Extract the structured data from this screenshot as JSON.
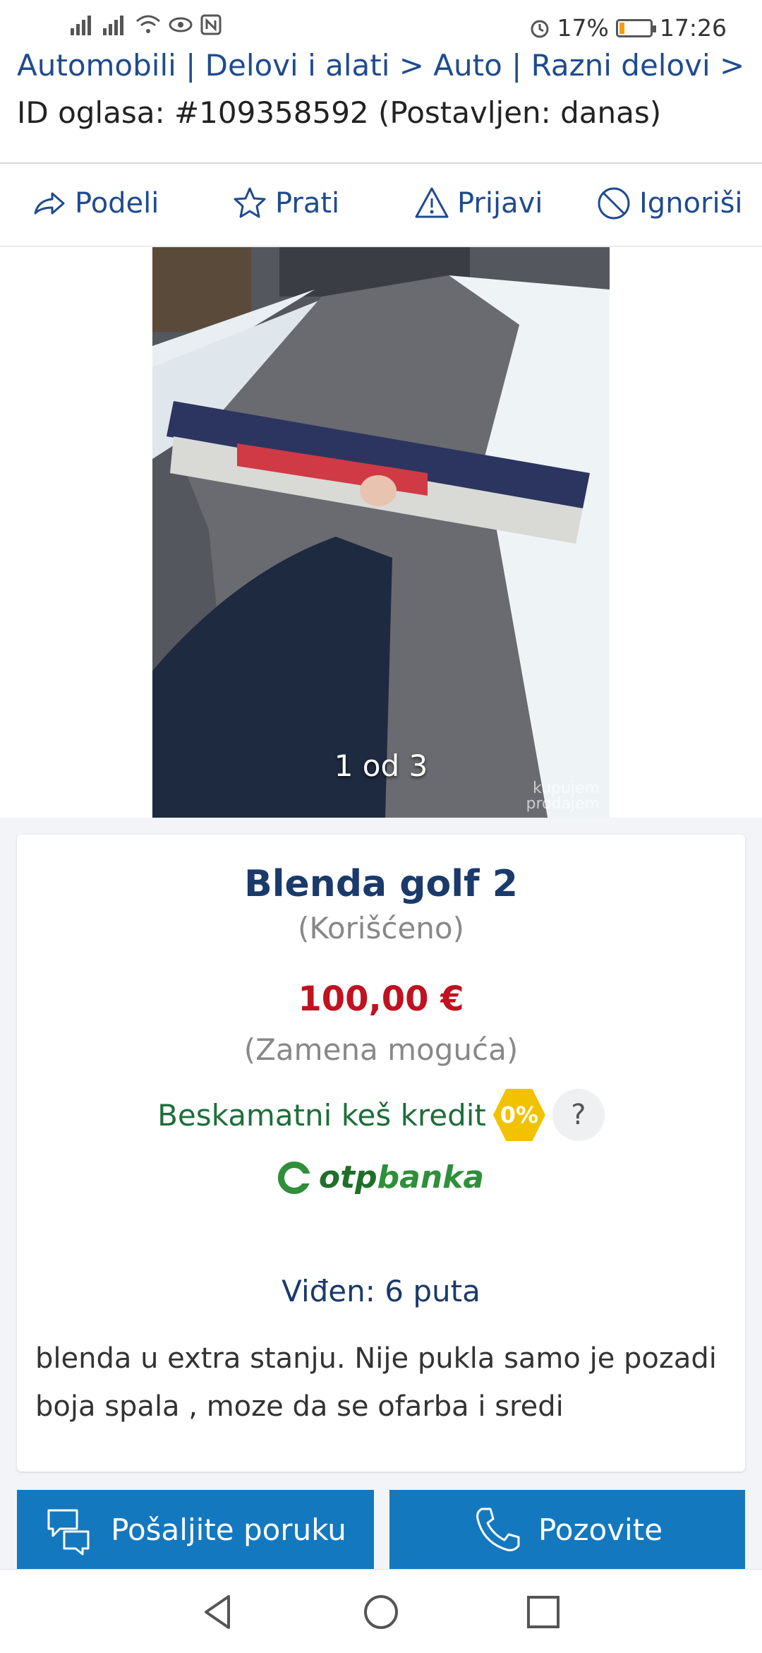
{
  "status": {
    "alarm_icon": "alarm-icon",
    "battery": "17%",
    "battery_level": 0.17,
    "time": "17:26"
  },
  "breadcrumb": {
    "path": "Automobili | Delovi i alati > Auto | Razni delovi >",
    "ad_id": "ID oglasa: #109358592 (Postavljen: danas)"
  },
  "actions": [
    {
      "label": "Podeli",
      "icon": "share-icon"
    },
    {
      "label": "Prati",
      "icon": "star-icon"
    },
    {
      "label": "Prijavi",
      "icon": "warning-icon"
    },
    {
      "label": "Ignoriši",
      "icon": "block-icon"
    }
  ],
  "photo": {
    "counter": "1 od 3",
    "watermark_line1": "kupujem",
    "watermark_line2": "prodajem"
  },
  "listing": {
    "title": "Blenda golf 2",
    "condition": "(Korišćeno)",
    "price": "100,00 €",
    "exchange": "(Zamena moguća)",
    "credit_text": "Beskamatni keš kredit",
    "credit_badge": "0%",
    "help": "?",
    "bank_name_part1": "otp",
    "bank_name_part2": "banka",
    "views": "Viđen: 6 puta",
    "description": "blenda u extra stanju. Nije pukla samo je pozadi boja spala , moze da se ofarba i sredi"
  },
  "buttons": {
    "message": "Pošaljite poruku",
    "call": "Pozovite"
  },
  "colors": {
    "accent_blue": "#1478bf",
    "link_blue": "#1f4b8f",
    "price_red": "#c0121f",
    "credit_green": "#1e6e3a"
  }
}
